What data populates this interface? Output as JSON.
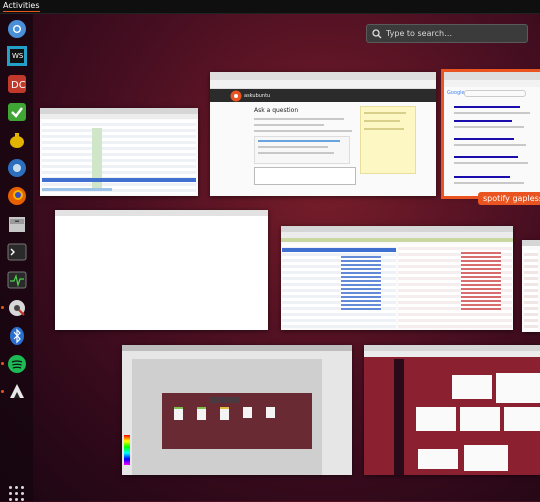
{
  "topbar": {
    "activities_label": "Activities"
  },
  "search": {
    "placeholder": "Type to search…",
    "icon": "magnifier-icon"
  },
  "dock": {
    "items": [
      {
        "name": "chromium-icon",
        "color": "#4a90d9"
      },
      {
        "name": "webstorm-icon",
        "color": "#1e1e1e"
      },
      {
        "name": "pdf-app-icon",
        "color": "#c0392b"
      },
      {
        "name": "tasks-check-icon",
        "color": "#3fa535"
      },
      {
        "name": "teapot-icon",
        "color": "#e0b400"
      },
      {
        "name": "update-icon",
        "color": "#2c6fbf"
      },
      {
        "name": "firefox-icon",
        "color": "#e66000"
      },
      {
        "name": "file-cabinet-icon",
        "color": "#c7c7c7"
      },
      {
        "name": "terminal-icon",
        "color": "#2a2a2a"
      },
      {
        "name": "system-monitor-icon",
        "color": "#2a2a2a"
      },
      {
        "name": "settings-gear-icon",
        "color": "#d8d8d8"
      },
      {
        "name": "bluetooth-icon",
        "color": "#2a6fd0"
      },
      {
        "name": "spotify-icon",
        "color": "#1db954"
      },
      {
        "name": "inkscape-icon",
        "color": "#e8e8e8"
      }
    ],
    "apps_grid_icon": "show-applications-icon"
  },
  "windows": {
    "askubuntu": {
      "heading": "Ask a question",
      "brand": "askubuntu"
    },
    "google": {
      "brand": "Google"
    },
    "caption": "spotify gapless tv -"
  }
}
